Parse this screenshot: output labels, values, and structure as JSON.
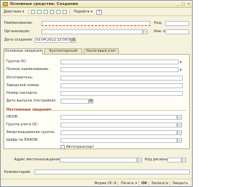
{
  "window": {
    "title": "Основные средства: Создание",
    "btn_min": "_",
    "btn_max": "□",
    "btn_close": "×"
  },
  "toolbar": {
    "actions": "Действия",
    "go": "Перейти",
    "help": "?"
  },
  "header": {
    "name_label": "Наименование:",
    "code_label": "Код:",
    "org_label": "Организация:",
    "inv_label": "Инв. №:",
    "date_label": "Дата создания:",
    "date_value": "03.04.2012 23:59:59"
  },
  "tabs": [
    {
      "label": "Основные сведения"
    },
    {
      "label": "Бухгалтерский учет"
    },
    {
      "label": "Налоговый учет"
    }
  ],
  "main": {
    "group_label": "Группа ОС:",
    "fullname_label": "Полное наименование:",
    "maker_label": "Изготовитель:",
    "serial_label": "Заводской номер:",
    "passport_label": "Номер паспорта:",
    "release_label": "Дата выпуска (постройки):",
    "permanent_section": "Постоянные сведения",
    "okof_label": "ОКОФ:",
    "account_group_label": "Группа учета ОС:",
    "amort_label": "Амортизационная группа:",
    "enaof_label": "Шифр по ЕНАОФ:",
    "auto_label": "Автотранспорт",
    "address_label": "Адрес местонахождения:",
    "region_label": "Код региона:"
  },
  "comment_label": "Комментарий:",
  "status": {
    "form": "Форма ОС-6",
    "print": "Печать",
    "ok": "OK",
    "save": "Записать",
    "close": "Закрыть"
  }
}
